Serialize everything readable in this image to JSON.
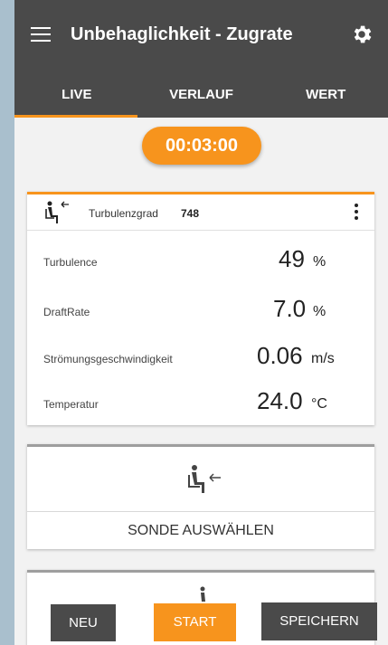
{
  "header": {
    "title": "Unbehaglichkeit - Zugrate"
  },
  "tabs": [
    {
      "label": "LIVE"
    },
    {
      "label": "VERLAUF"
    },
    {
      "label": "WERT"
    }
  ],
  "timer": "00:03:00",
  "card": {
    "turbulence_degree_label": "Turbulenzgrad",
    "turbulence_degree_value": "748",
    "rows": [
      {
        "label": "Turbulence",
        "value": "49",
        "unit": "%"
      },
      {
        "label": "DraftRate",
        "value": "7.0",
        "unit": "%"
      },
      {
        "label": "Strömungsgeschwindigkeit",
        "value": "0.06",
        "unit": "m/s"
      },
      {
        "label": "Temperatur",
        "value": "24.0",
        "unit": "°C"
      }
    ]
  },
  "probe_card": {
    "select_label": "SONDE AUSWÄHLEN"
  },
  "buttons": {
    "new": "NEU",
    "start": "START",
    "save": "SPEICHERN"
  },
  "colors": {
    "accent": "#f7941d",
    "appbar": "#4a4a4a",
    "background": "#f2f2f2"
  }
}
